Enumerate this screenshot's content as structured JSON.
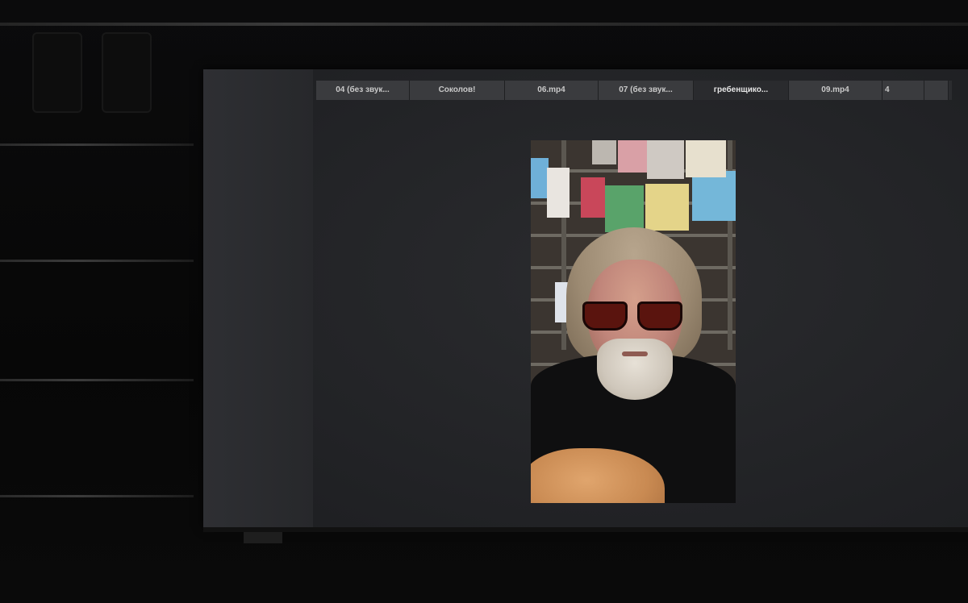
{
  "player": {
    "tabs": [
      {
        "label": "04 (без звук...",
        "active": false
      },
      {
        "label": "Соколов!",
        "active": false
      },
      {
        "label": "06.mp4",
        "active": false
      },
      {
        "label": "07 (без звук...",
        "active": false
      },
      {
        "label": "гребенщико...",
        "active": true
      },
      {
        "label": "09.mp4",
        "active": false
      },
      {
        "label": "4",
        "active": false
      },
      {
        "label": "",
        "active": false
      }
    ]
  },
  "colors": {
    "flag_colors": [
      "#6fb0d8",
      "#e9e5e0",
      "#c9475a",
      "#59a36a",
      "#e4d489",
      "#74b7d9",
      "#d9a0a6",
      "#cfc9c3",
      "#e7e0ce"
    ]
  }
}
